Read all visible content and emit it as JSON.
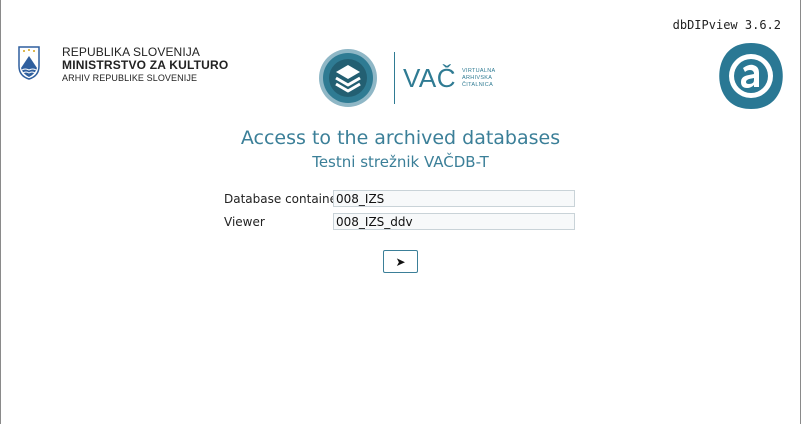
{
  "app": {
    "version_label": "dbDIPview 3.6.2"
  },
  "header": {
    "ministry": {
      "line1": "REPUBLIKA SLOVENIJA",
      "line2": "MINISTRSTVO ZA KULTURO",
      "line3": "ARHIV REPUBLIKE SLOVENIJE"
    },
    "vac": {
      "word": "VAČ",
      "sub1": "VIRTUALNA",
      "sub2": "ARHIVSKA",
      "sub3": "ČITALNICA"
    }
  },
  "main": {
    "title": "Access to the archived databases",
    "subtitle": "Testni strežnik VAČDB-T",
    "form": {
      "container_label": "Database container",
      "container_value": "008_IZS",
      "viewer_label": "Viewer",
      "viewer_value": "008_IZS_ddv",
      "submit_glyph": "➤"
    }
  },
  "colors": {
    "accent": "#3b7f98",
    "logo_teal": "#2f7b93",
    "background": "#ffffff"
  }
}
